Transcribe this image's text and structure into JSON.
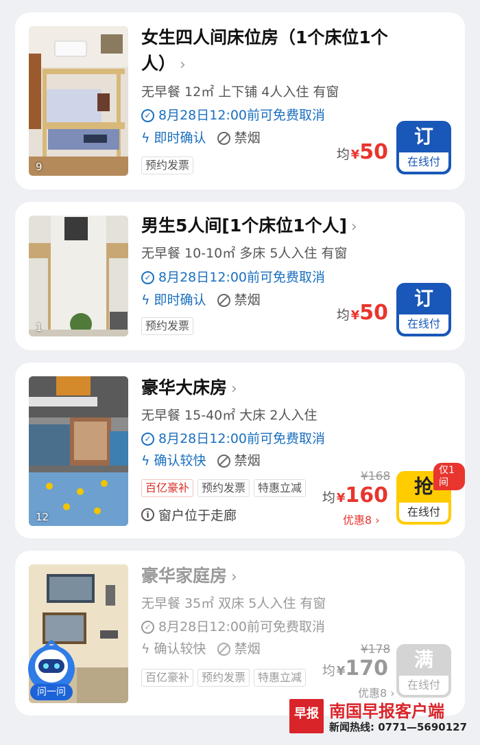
{
  "rooms": [
    {
      "title_line1": "女生四人间床位房（1个床位1个",
      "title_line2": "人）",
      "chevron": "›",
      "specs": "无早餐  12㎡  上下铺  4人入住  有窗",
      "cancel": "8月28日12:00前可免费取消",
      "confirm": "即时确认",
      "no_smoking": "禁烟",
      "tags": [
        "预约发票"
      ],
      "price_prefix": "均",
      "currency": "¥",
      "price": "50",
      "button_main": "订",
      "button_sub": "在线付",
      "photo_count": "9"
    },
    {
      "title": "男生5人间[1个床位1个人]",
      "chevron": "›",
      "specs": "无早餐  10-10㎡  多床  5人入住  有窗",
      "cancel": "8月28日12:00前可免费取消",
      "confirm": "即时确认",
      "no_smoking": "禁烟",
      "tags": [
        "预约发票"
      ],
      "price_prefix": "均",
      "currency": "¥",
      "price": "50",
      "button_main": "订",
      "button_sub": "在线付",
      "photo_count": "1"
    },
    {
      "title": "豪华大床房",
      "chevron": "›",
      "specs": "无早餐  15-40㎡  大床  2人入住",
      "cancel": "8月28日12:00前可免费取消",
      "confirm": "确认较快",
      "no_smoking": "禁烟",
      "tags": [
        "百亿豪补",
        "预约发票",
        "特惠立减"
      ],
      "note": "窗户位于走廊",
      "old_price": "¥168",
      "price_prefix": "均",
      "currency": "¥",
      "price": "160",
      "discount": "优惠8 ›",
      "button_main": "抢",
      "button_sub": "在线付",
      "limit_badge": "仅1间",
      "photo_count": "12"
    },
    {
      "title": "豪华家庭房",
      "chevron": "›",
      "specs": "无早餐  35㎡  双床  5人入住  有窗",
      "cancel": "8月28日12:00前可免费取消",
      "confirm": "确认较快",
      "no_smoking": "禁烟",
      "tags": [
        "百亿豪补",
        "预约发票",
        "特惠立减"
      ],
      "old_price": "¥178",
      "price_prefix": "均",
      "currency": "¥",
      "price": "170",
      "discount": "优惠8 ›",
      "button_main": "满",
      "button_sub": "在线付"
    }
  ],
  "assistant": {
    "label": "问一问"
  },
  "watermark": {
    "logo_text": "早报",
    "title": "南国早报客户端",
    "hotline": "新闻热线: 0771—5690127"
  },
  "colors": {
    "accent_blue": "#1957b8",
    "price_red": "#e8352e",
    "grab_yellow": "#ffcc00",
    "soldout_gray": "#d4d4d4"
  }
}
